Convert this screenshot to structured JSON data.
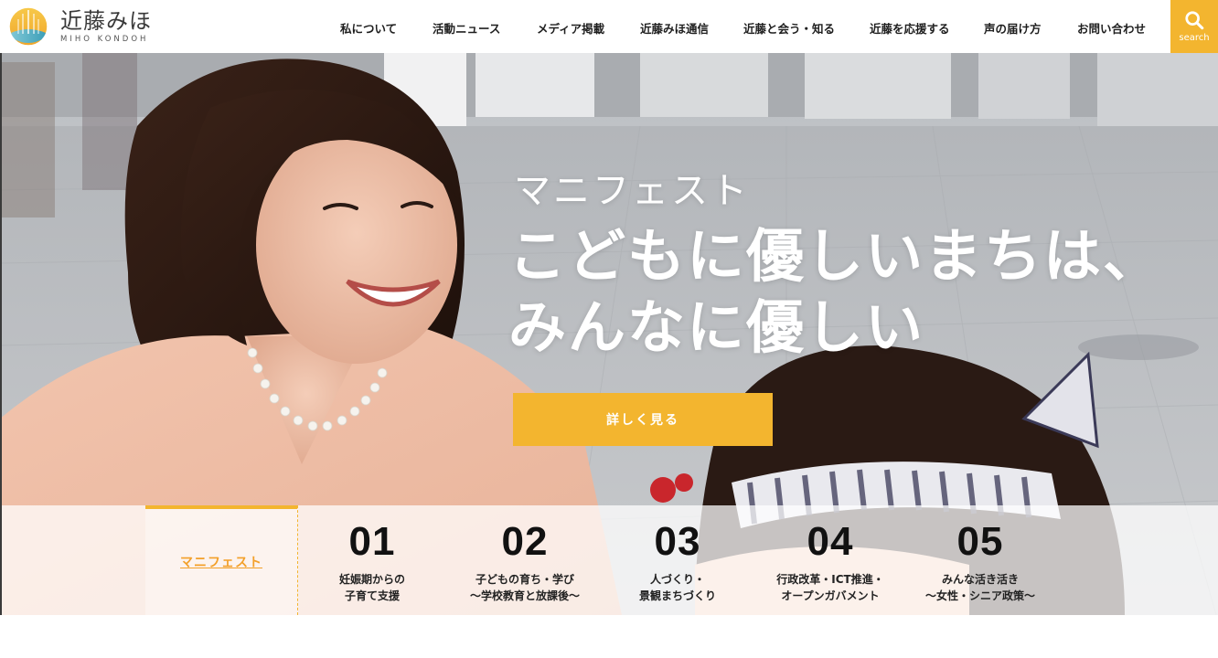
{
  "header": {
    "logo_name": "近藤みほ",
    "logo_sub": "MIHO KONDOH",
    "nav": [
      {
        "label": "私について"
      },
      {
        "label": "活動ニュース"
      },
      {
        "label": "メディア掲載"
      },
      {
        "label": "近藤みほ通信"
      },
      {
        "label": "近藤と会う・知る"
      },
      {
        "label": "近藤を応援する"
      },
      {
        "label": "声の届け方"
      },
      {
        "label": "お問い合わせ"
      }
    ],
    "search_label": "search",
    "search_icon": "search-icon"
  },
  "hero": {
    "eyebrow": "マニフェスト",
    "title_line1": "こどもに優しいまちは、",
    "title_line2": "みんなに優しい",
    "cta_label": "詳しく見る"
  },
  "manifesto": {
    "tab_label": "マニフェスト",
    "items": [
      {
        "num": "01",
        "line1": "妊娠期からの",
        "line2": "子育て支援"
      },
      {
        "num": "02",
        "line1": "子どもの育ち・学び",
        "line2": "～学校教育と放課後～"
      },
      {
        "num": "03",
        "line1": "人づくり・",
        "line2": "景観まちづくり"
      },
      {
        "num": "04",
        "line1": "行政改革・ICT推進・",
        "line2": "オープンガバメント"
      },
      {
        "num": "05",
        "line1": "みんな活き活き",
        "line2": "～女性・シニア政策～"
      }
    ]
  },
  "colors": {
    "accent": "#f3b52f",
    "text": "#1e1e1e"
  }
}
